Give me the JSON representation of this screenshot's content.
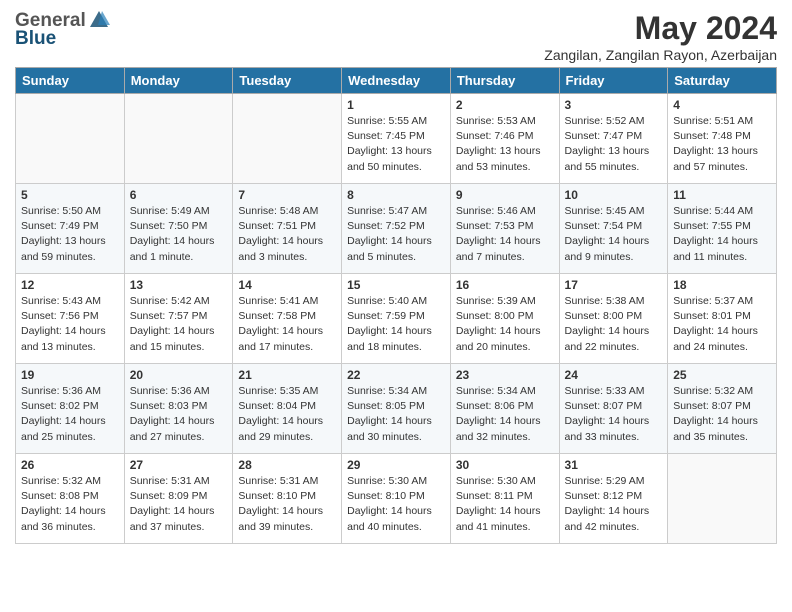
{
  "logo": {
    "general": "General",
    "blue": "Blue"
  },
  "title": "May 2024",
  "location": "Zangilan, Zangilan Rayon, Azerbaijan",
  "days_of_week": [
    "Sunday",
    "Monday",
    "Tuesday",
    "Wednesday",
    "Thursday",
    "Friday",
    "Saturday"
  ],
  "weeks": [
    [
      {
        "day": "",
        "info": ""
      },
      {
        "day": "",
        "info": ""
      },
      {
        "day": "",
        "info": ""
      },
      {
        "day": "1",
        "info": "Sunrise: 5:55 AM\nSunset: 7:45 PM\nDaylight: 13 hours\nand 50 minutes."
      },
      {
        "day": "2",
        "info": "Sunrise: 5:53 AM\nSunset: 7:46 PM\nDaylight: 13 hours\nand 53 minutes."
      },
      {
        "day": "3",
        "info": "Sunrise: 5:52 AM\nSunset: 7:47 PM\nDaylight: 13 hours\nand 55 minutes."
      },
      {
        "day": "4",
        "info": "Sunrise: 5:51 AM\nSunset: 7:48 PM\nDaylight: 13 hours\nand 57 minutes."
      }
    ],
    [
      {
        "day": "5",
        "info": "Sunrise: 5:50 AM\nSunset: 7:49 PM\nDaylight: 13 hours\nand 59 minutes."
      },
      {
        "day": "6",
        "info": "Sunrise: 5:49 AM\nSunset: 7:50 PM\nDaylight: 14 hours\nand 1 minute."
      },
      {
        "day": "7",
        "info": "Sunrise: 5:48 AM\nSunset: 7:51 PM\nDaylight: 14 hours\nand 3 minutes."
      },
      {
        "day": "8",
        "info": "Sunrise: 5:47 AM\nSunset: 7:52 PM\nDaylight: 14 hours\nand 5 minutes."
      },
      {
        "day": "9",
        "info": "Sunrise: 5:46 AM\nSunset: 7:53 PM\nDaylight: 14 hours\nand 7 minutes."
      },
      {
        "day": "10",
        "info": "Sunrise: 5:45 AM\nSunset: 7:54 PM\nDaylight: 14 hours\nand 9 minutes."
      },
      {
        "day": "11",
        "info": "Sunrise: 5:44 AM\nSunset: 7:55 PM\nDaylight: 14 hours\nand 11 minutes."
      }
    ],
    [
      {
        "day": "12",
        "info": "Sunrise: 5:43 AM\nSunset: 7:56 PM\nDaylight: 14 hours\nand 13 minutes."
      },
      {
        "day": "13",
        "info": "Sunrise: 5:42 AM\nSunset: 7:57 PM\nDaylight: 14 hours\nand 15 minutes."
      },
      {
        "day": "14",
        "info": "Sunrise: 5:41 AM\nSunset: 7:58 PM\nDaylight: 14 hours\nand 17 minutes."
      },
      {
        "day": "15",
        "info": "Sunrise: 5:40 AM\nSunset: 7:59 PM\nDaylight: 14 hours\nand 18 minutes."
      },
      {
        "day": "16",
        "info": "Sunrise: 5:39 AM\nSunset: 8:00 PM\nDaylight: 14 hours\nand 20 minutes."
      },
      {
        "day": "17",
        "info": "Sunrise: 5:38 AM\nSunset: 8:00 PM\nDaylight: 14 hours\nand 22 minutes."
      },
      {
        "day": "18",
        "info": "Sunrise: 5:37 AM\nSunset: 8:01 PM\nDaylight: 14 hours\nand 24 minutes."
      }
    ],
    [
      {
        "day": "19",
        "info": "Sunrise: 5:36 AM\nSunset: 8:02 PM\nDaylight: 14 hours\nand 25 minutes."
      },
      {
        "day": "20",
        "info": "Sunrise: 5:36 AM\nSunset: 8:03 PM\nDaylight: 14 hours\nand 27 minutes."
      },
      {
        "day": "21",
        "info": "Sunrise: 5:35 AM\nSunset: 8:04 PM\nDaylight: 14 hours\nand 29 minutes."
      },
      {
        "day": "22",
        "info": "Sunrise: 5:34 AM\nSunset: 8:05 PM\nDaylight: 14 hours\nand 30 minutes."
      },
      {
        "day": "23",
        "info": "Sunrise: 5:34 AM\nSunset: 8:06 PM\nDaylight: 14 hours\nand 32 minutes."
      },
      {
        "day": "24",
        "info": "Sunrise: 5:33 AM\nSunset: 8:07 PM\nDaylight: 14 hours\nand 33 minutes."
      },
      {
        "day": "25",
        "info": "Sunrise: 5:32 AM\nSunset: 8:07 PM\nDaylight: 14 hours\nand 35 minutes."
      }
    ],
    [
      {
        "day": "26",
        "info": "Sunrise: 5:32 AM\nSunset: 8:08 PM\nDaylight: 14 hours\nand 36 minutes."
      },
      {
        "day": "27",
        "info": "Sunrise: 5:31 AM\nSunset: 8:09 PM\nDaylight: 14 hours\nand 37 minutes."
      },
      {
        "day": "28",
        "info": "Sunrise: 5:31 AM\nSunset: 8:10 PM\nDaylight: 14 hours\nand 39 minutes."
      },
      {
        "day": "29",
        "info": "Sunrise: 5:30 AM\nSunset: 8:10 PM\nDaylight: 14 hours\nand 40 minutes."
      },
      {
        "day": "30",
        "info": "Sunrise: 5:30 AM\nSunset: 8:11 PM\nDaylight: 14 hours\nand 41 minutes."
      },
      {
        "day": "31",
        "info": "Sunrise: 5:29 AM\nSunset: 8:12 PM\nDaylight: 14 hours\nand 42 minutes."
      },
      {
        "day": "",
        "info": ""
      }
    ]
  ]
}
